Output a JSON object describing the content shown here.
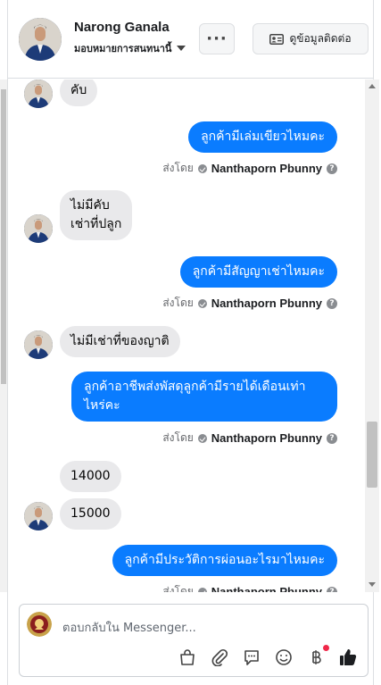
{
  "header": {
    "contact_name": "Narong Ganala",
    "assign_label": "มอบหมายการสนทนานี้",
    "more_label": "···",
    "info_button_label": "ดูข้อมูลติดต่อ"
  },
  "messages": [
    {
      "id": "m1",
      "direction": "incoming",
      "text": "คับ"
    },
    {
      "id": "m2",
      "direction": "outgoing",
      "text": "ลูกค้ามีเล่มเขียวไหมคะ",
      "sent_by_prefix": "ส่งโดย",
      "sent_by_name": "Nanthaporn Pbunny"
    },
    {
      "id": "m3",
      "direction": "incoming",
      "text": "ไม่มีคับ\nเช่าที่ปลูก"
    },
    {
      "id": "m4",
      "direction": "outgoing",
      "text": "ลูกค้ามีสัญญาเช่าไหมคะ",
      "sent_by_prefix": "ส่งโดย",
      "sent_by_name": "Nanthaporn Pbunny"
    },
    {
      "id": "m5",
      "direction": "incoming",
      "text": "ไม่มีเช่าที่ของญาติ"
    },
    {
      "id": "m6",
      "direction": "outgoing",
      "text": "ลูกค้าอาชีพส่งพัสดุลูกค้ามีรายได้เดือนเท่า\nไหร่คะ",
      "sent_by_prefix": "ส่งโดย",
      "sent_by_name": "Nanthaporn Pbunny"
    },
    {
      "id": "m7",
      "direction": "incoming",
      "text": "14000"
    },
    {
      "id": "m8",
      "direction": "incoming",
      "text": "15000"
    },
    {
      "id": "m9",
      "direction": "outgoing",
      "text": "ลูกค้ามีประวัติการผ่อนอะไรมาไหมคะ",
      "sent_by_prefix": "ส่งโดย",
      "sent_by_name": "Nanthaporn Pbunny"
    }
  ],
  "composer": {
    "placeholder": "ตอบกลับใน Messenger..."
  },
  "toolbar_icons": [
    "shopping-bag-icon",
    "paperclip-icon",
    "saved-reply-icon",
    "emoji-icon",
    "baht-payment-icon",
    "thumbs-up-icon"
  ],
  "colors": {
    "outgoing_bubble": "#0a7cff",
    "incoming_bubble": "#e9e9eb",
    "notification_dot": "#f02849"
  }
}
